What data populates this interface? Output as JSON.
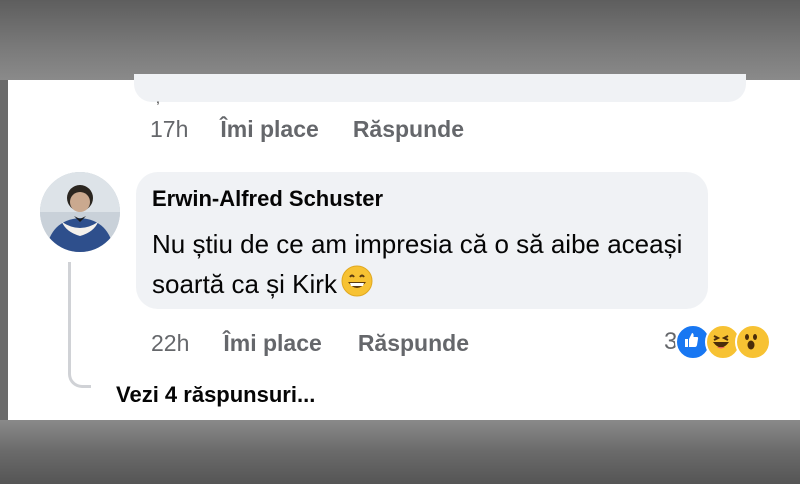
{
  "previous_comment": {
    "fragment": ",",
    "time": "17h",
    "like_label": "Îmi place",
    "reply_label": "Răspunde"
  },
  "comment": {
    "author": "Erwin-Alfred Schuster",
    "text": "Nu știu de ce am impresia că o să aibe aceași soartă ca și Kirk",
    "inline_emoji": "grinning-face-icon",
    "time": "22h",
    "like_label": "Îmi place",
    "reply_label": "Răspunde",
    "reactions": {
      "count": "3",
      "icons": [
        "like-reaction-icon",
        "haha-reaction-icon",
        "wow-reaction-icon"
      ]
    }
  },
  "view_replies_label": "Vezi 4 răspunsuri...",
  "colors": {
    "bubble": "#f0f2f5",
    "secondary_text": "#65676b",
    "like_blue": "#1877f2",
    "emoji_yellow": "#f7c233"
  }
}
